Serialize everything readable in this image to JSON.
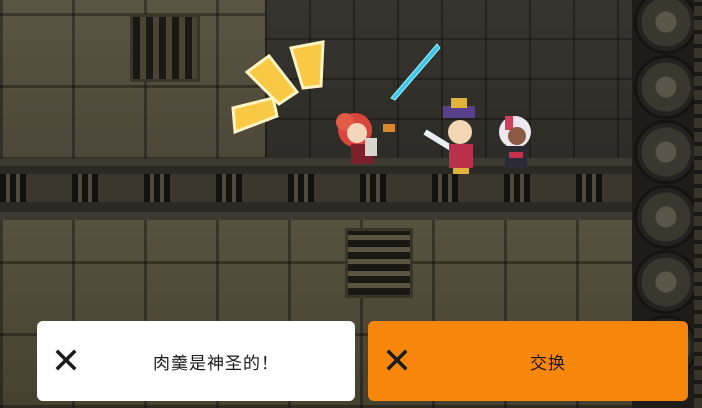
{
  "dialog": {
    "option_1": {
      "icon": "close-icon",
      "label": "肉羹是神圣的！"
    },
    "option_2": {
      "icon": "close-icon",
      "label": "交换"
    }
  },
  "colors": {
    "option_1_bg": "#ffffff",
    "option_2_bg": "#f7870c",
    "burst": "#f9c844"
  }
}
